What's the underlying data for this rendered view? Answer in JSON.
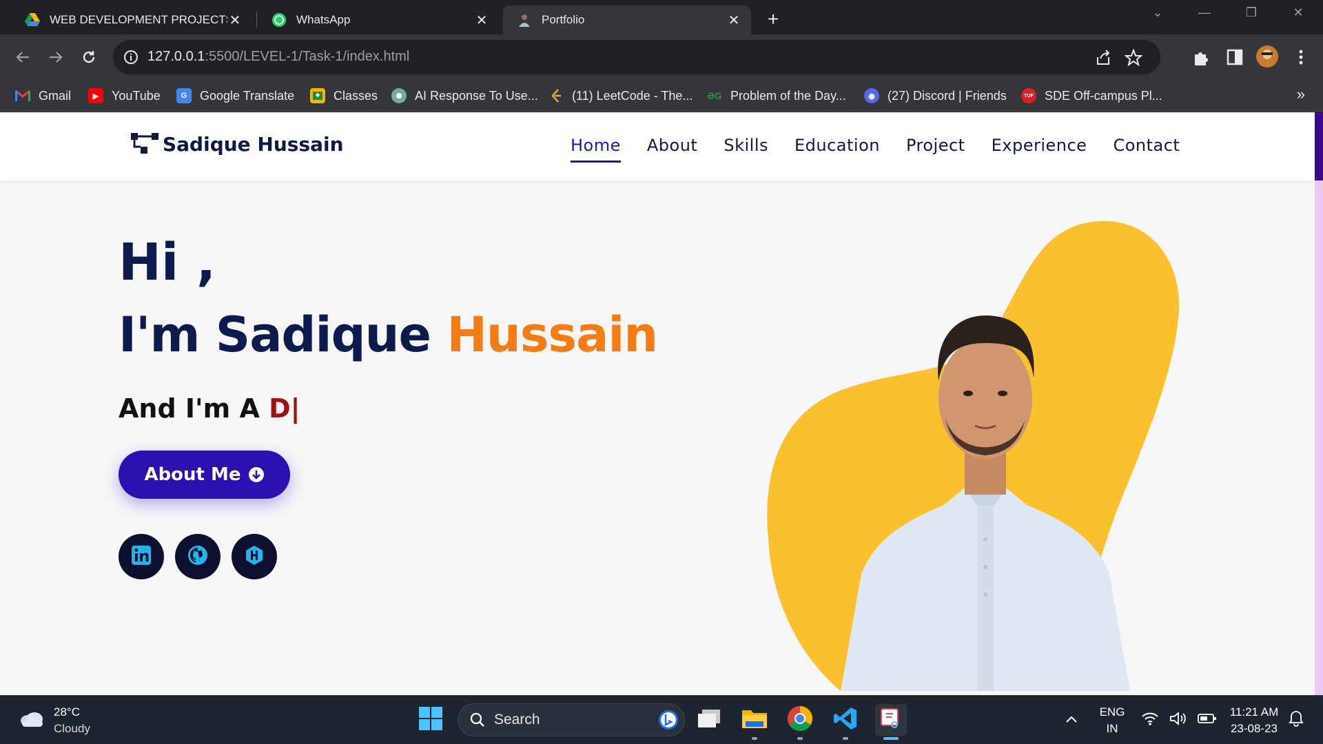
{
  "browser": {
    "tabs": [
      {
        "title": "WEB DEVELOPMENT PROJECTS.p",
        "icon": "google-drive-icon",
        "active": false
      },
      {
        "title": "WhatsApp",
        "icon": "whatsapp-icon",
        "active": false
      },
      {
        "title": "Portfolio",
        "icon": "portfolio-favicon",
        "active": true
      }
    ],
    "url_host": "127.0.0.1",
    "url_path": ":5500/LEVEL-1/Task-1/index.html",
    "bookmarks": [
      {
        "label": "Gmail",
        "icon": "gmail-icon",
        "color": "#ea4335"
      },
      {
        "label": "YouTube",
        "icon": "youtube-icon",
        "color": "#ff0000"
      },
      {
        "label": "Google Translate",
        "icon": "google-translate-icon",
        "color": "#4285f4"
      },
      {
        "label": "Classes",
        "icon": "google-classroom-icon",
        "color": "#f4b400"
      },
      {
        "label": "AI Response To Use...",
        "icon": "chatgpt-icon",
        "color": "#74aa9c"
      },
      {
        "label": "(11) LeetCode - The...",
        "icon": "leetcode-icon",
        "color": "#ffa116"
      },
      {
        "label": "Problem of the Day...",
        "icon": "geeksforgeeks-icon",
        "color": "#2f8d46"
      },
      {
        "label": "(27) Discord | Friends",
        "icon": "discord-icon",
        "color": "#5865f2"
      },
      {
        "label": "SDE Off-campus Pl...",
        "icon": "tuf-icon",
        "color": "#e01e2b"
      }
    ]
  },
  "site": {
    "logo_text": "Sadique Hussain",
    "nav": [
      {
        "label": "Home",
        "active": true
      },
      {
        "label": "About",
        "active": false
      },
      {
        "label": "Skills",
        "active": false
      },
      {
        "label": "Education",
        "active": false
      },
      {
        "label": "Project",
        "active": false
      },
      {
        "label": "Experience",
        "active": false
      },
      {
        "label": "Contact",
        "active": false
      }
    ],
    "hero": {
      "greeting": "Hi ,",
      "intro_prefix": "I'm Sadique ",
      "intro_accent": "Hussain",
      "typing_prefix": "And I'm A ",
      "typing_text": "D|",
      "button_label": "About Me",
      "socials": [
        "linkedin-icon",
        "github-icon",
        "hashnode-icon"
      ]
    },
    "colors": {
      "navy": "#0d1b4c",
      "accent": "#f57c11",
      "button": "#2c0fb0",
      "blob": "#fbc02d"
    }
  },
  "taskbar": {
    "temperature": "28°C",
    "condition": "Cloudy",
    "search_placeholder": "Search",
    "language_top": "ENG",
    "language_bottom": "IN",
    "time": "11:21 AM",
    "date": "23-08-23"
  }
}
